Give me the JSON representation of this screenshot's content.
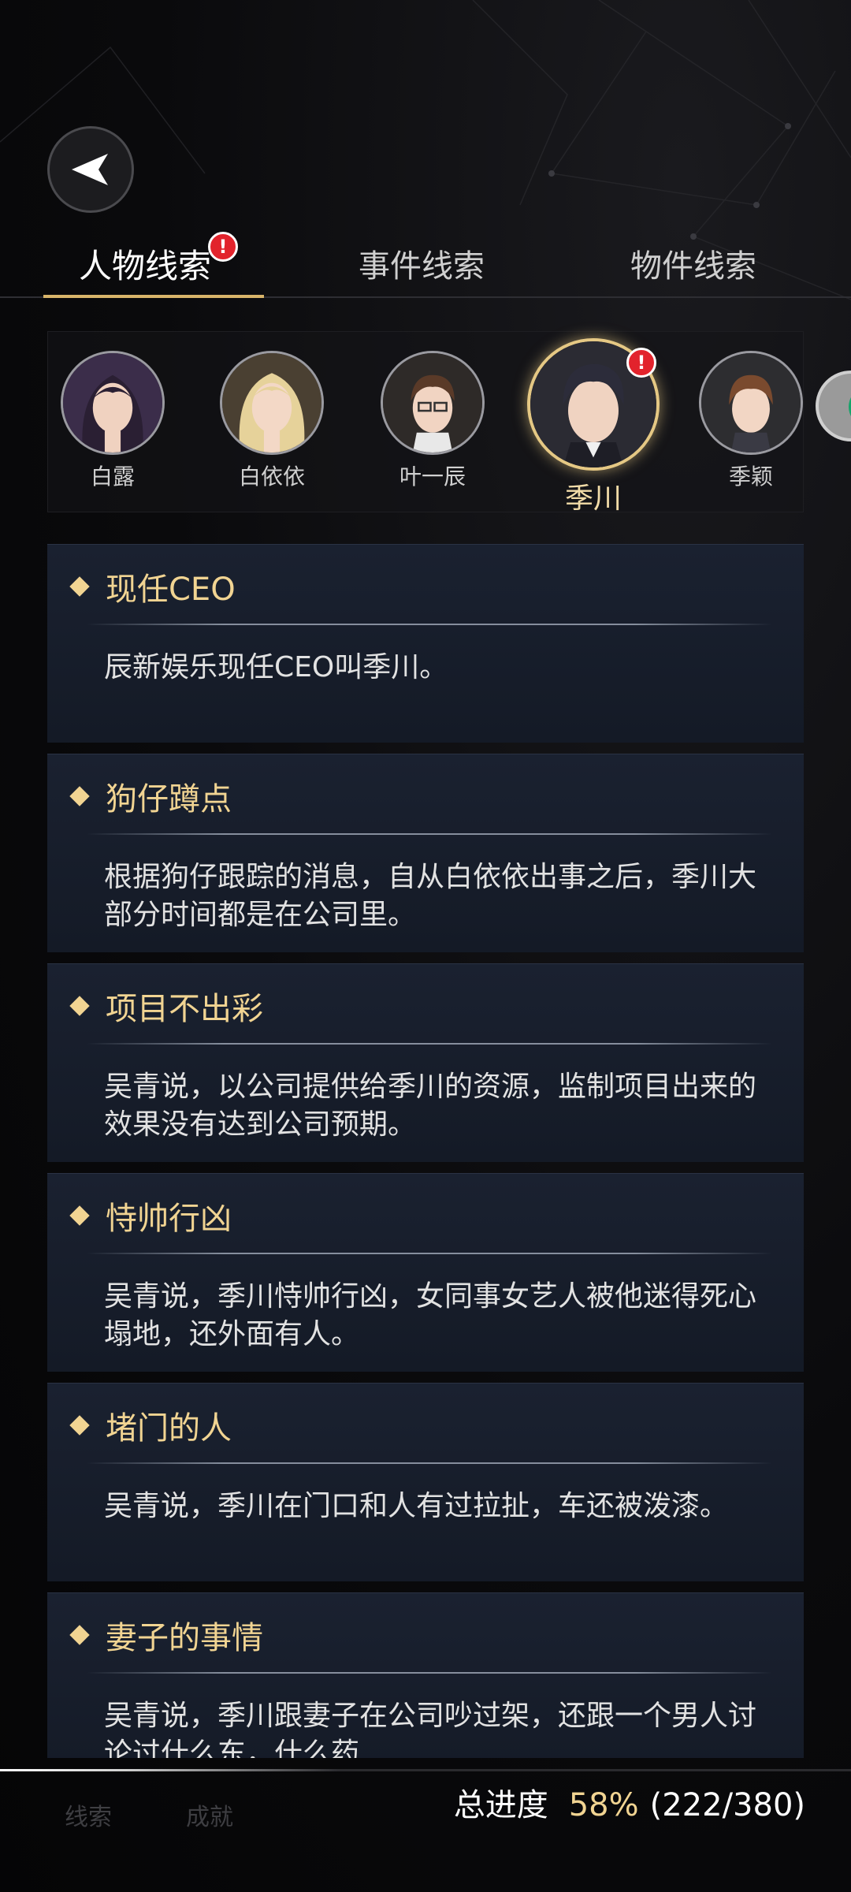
{
  "tabs": [
    {
      "label": "人物线索",
      "active": true,
      "badge": "!"
    },
    {
      "label": "事件线索",
      "active": false
    },
    {
      "label": "物件线索",
      "active": false
    }
  ],
  "characters": [
    {
      "name": "白露",
      "selected": false
    },
    {
      "name": "白依依",
      "selected": false
    },
    {
      "name": "叶一辰",
      "selected": false
    },
    {
      "name": "季川",
      "selected": true,
      "badge": "!"
    },
    {
      "name": "季颖",
      "selected": false
    }
  ],
  "clues": [
    {
      "title": "现任CEO",
      "body": "辰新娱乐现任CEO叫季川。"
    },
    {
      "title": "狗仔蹲点",
      "body": "根据狗仔跟踪的消息，自从白依依出事之后，季川大部分时间都是在公司里。"
    },
    {
      "title": "项目不出彩",
      "body": "吴青说，以公司提供给季川的资源，监制项目出来的效果没有达到公司预期。"
    },
    {
      "title": "恃帅行凶",
      "body": "吴青说，季川恃帅行凶，女同事女艺人被他迷得死心塌地，还外面有人。"
    },
    {
      "title": "堵门的人",
      "body": "吴青说，季川在门口和人有过拉扯，车还被泼漆。"
    },
    {
      "title": "妻子的事情",
      "body": "吴青说，季川跟妻子在公司吵过架，还跟一个男人讨论过什么东，什么药"
    }
  ],
  "bottom_nav": [
    {
      "label": "线索"
    },
    {
      "label": "成就"
    }
  ],
  "progress": {
    "label": "总进度",
    "percent": "58%",
    "count": "(222/380)"
  },
  "colors": {
    "accent_gold": "#f1d492",
    "badge_red": "#e2232c",
    "card_bg": "#171d2a"
  }
}
